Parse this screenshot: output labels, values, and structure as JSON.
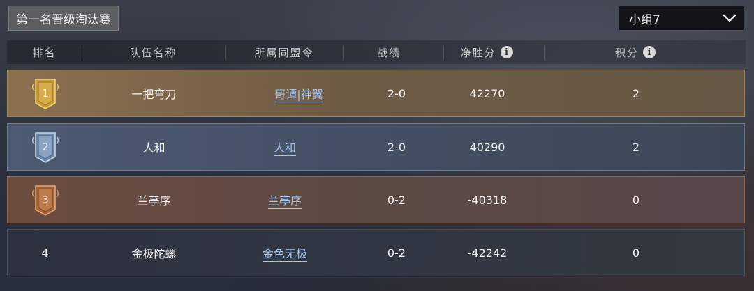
{
  "title": "第一名晋级淘汰赛",
  "group_select": {
    "value": "小组7"
  },
  "columns": {
    "rank": "排名",
    "team": "队伍名称",
    "alliance": "所属同盟令",
    "record": "战绩",
    "net_score": "净胜分",
    "points": "积分"
  },
  "rows": [
    {
      "rank": "1",
      "team": "一把弯刀",
      "alliance": "哥谭|神翼",
      "record": "2-0",
      "net_score": "42270",
      "points": "2"
    },
    {
      "rank": "2",
      "team": "人和",
      "alliance": "人和",
      "record": "2-0",
      "net_score": "40290",
      "points": "2"
    },
    {
      "rank": "3",
      "team": "兰亭序",
      "alliance": "兰亭序",
      "record": "0-2",
      "net_score": "-40318",
      "points": "0"
    },
    {
      "rank": "4",
      "team": "金极陀螺",
      "alliance": "金色无极",
      "record": "0-2",
      "net_score": "-42242",
      "points": "0"
    }
  ],
  "icons": {
    "info": "info-icon",
    "dropdown": "chevron-down-icon",
    "badges": [
      "gold-rank-badge",
      "silver-rank-badge",
      "bronze-rank-badge"
    ]
  },
  "colors": {
    "gold": "#c9a24a",
    "silver": "#8fa7c4",
    "bronze": "#b07040",
    "link": "#a9c6ee"
  }
}
